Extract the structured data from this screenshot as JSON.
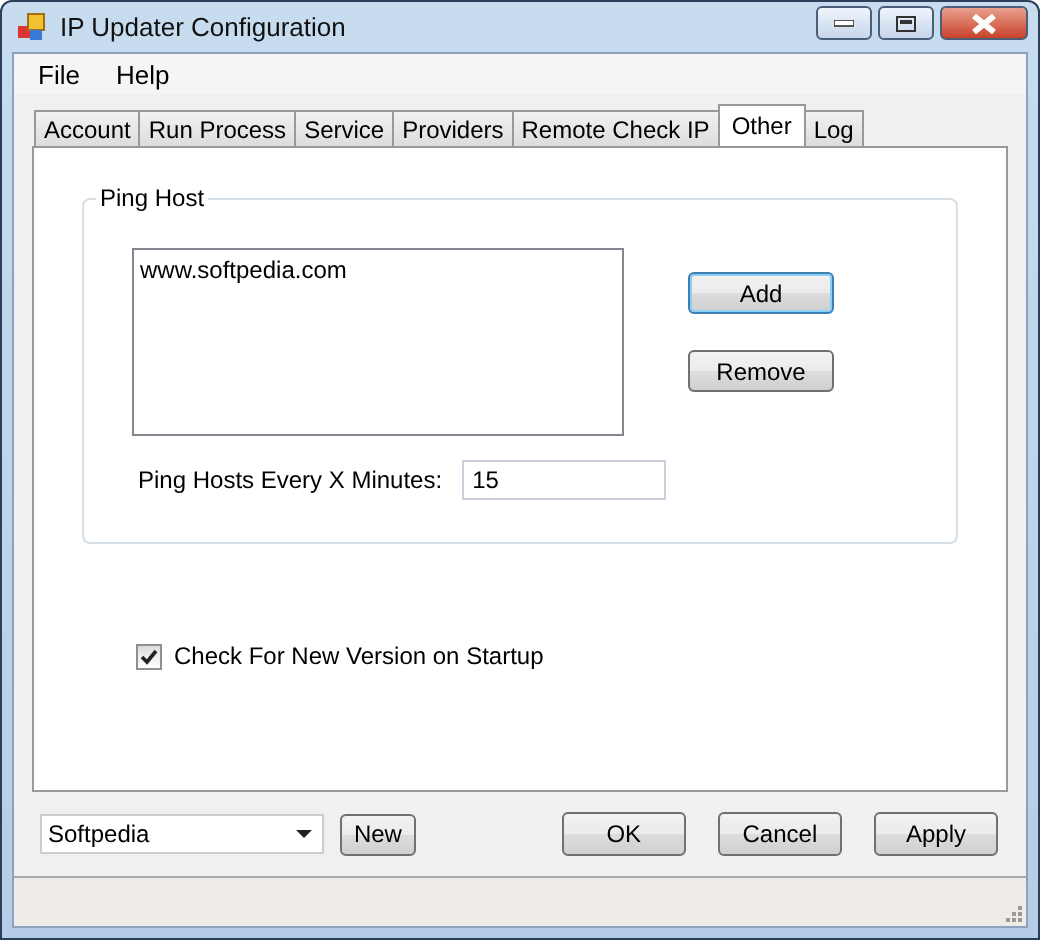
{
  "window": {
    "title": "IP Updater Configuration"
  },
  "menu": [
    "File",
    "Help"
  ],
  "tabs": [
    {
      "label": "Account",
      "selected": false
    },
    {
      "label": "Run Process",
      "selected": false
    },
    {
      "label": "Service",
      "selected": false
    },
    {
      "label": "Providers",
      "selected": false
    },
    {
      "label": "Remote Check IP",
      "selected": false
    },
    {
      "label": "Other",
      "selected": true
    },
    {
      "label": "Log",
      "selected": false
    }
  ],
  "ping_host": {
    "title": "Ping Host",
    "hosts": [
      "www.softpedia.com"
    ],
    "buttons": [
      "Add",
      "Remove"
    ],
    "interval_label": "Ping Hosts Every X Minutes:",
    "interval_value": "15"
  },
  "check_version": {
    "label": "Check For New Version on Startup",
    "checked": true
  },
  "profile": {
    "value": "Softpedia",
    "button": "New"
  },
  "buttons": [
    "OK",
    "Cancel",
    "Apply"
  ]
}
